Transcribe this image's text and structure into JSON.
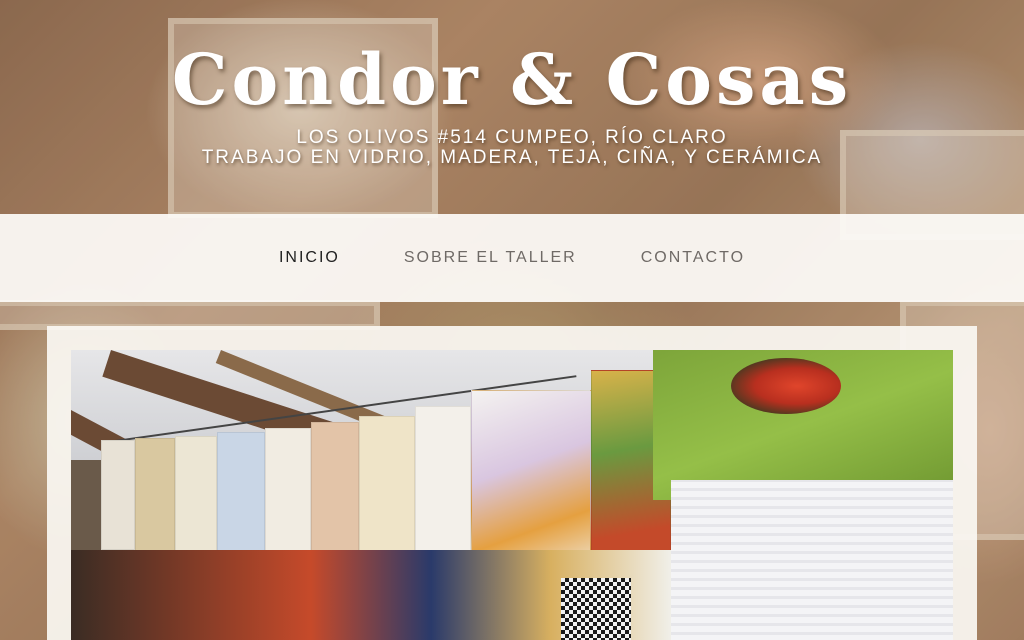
{
  "header": {
    "site_title": "Condor & Cosas",
    "tagline_line1": "LOS OLIVOS #514 CUMPEO, RÍO CLARO",
    "tagline_line2": "TRABAJO EN VIDRIO, MADERA, TEJA, CIÑA, Y CERÁMICA"
  },
  "nav": {
    "items": [
      {
        "label": "INICIO",
        "active": true
      },
      {
        "label": "SOBRE EL TALLER",
        "active": false
      },
      {
        "label": "CONTACTO",
        "active": false
      }
    ]
  },
  "colors": {
    "nav_background": "#fcfaf6",
    "nav_text": "#6f6a66",
    "nav_active_text": "#222222",
    "title_text": "#ffffff"
  }
}
